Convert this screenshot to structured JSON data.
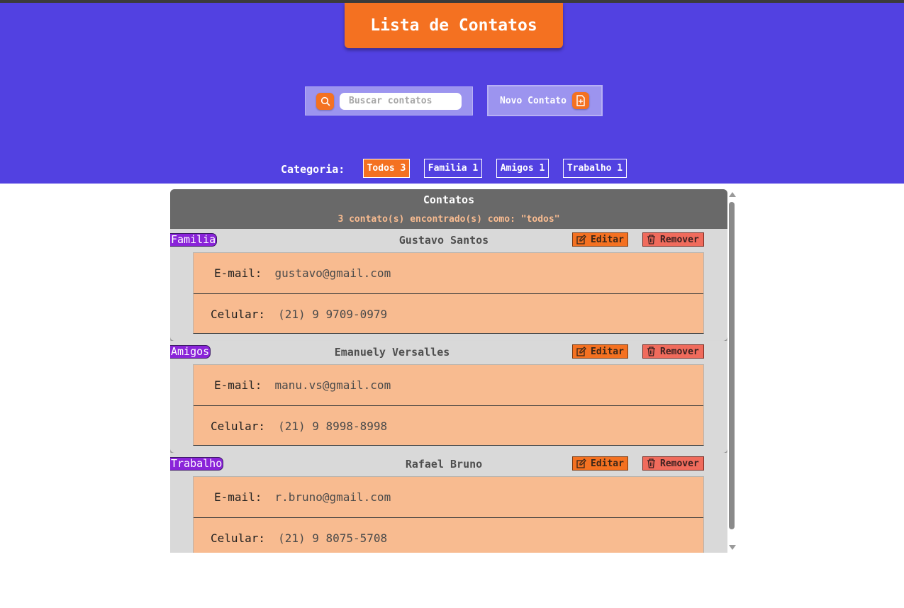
{
  "header": {
    "title": "Lista de Contatos",
    "search": {
      "placeholder": "Buscar contatos",
      "value": "",
      "icon": "search-icon"
    },
    "new_contact": {
      "label": "Novo Contato",
      "icon": "file-plus-icon"
    },
    "category": {
      "label": "Categoria:",
      "options": [
        {
          "label": "Todos 3",
          "active": true
        },
        {
          "label": "Familia 1",
          "active": false
        },
        {
          "label": "Amigos 1",
          "active": false
        },
        {
          "label": "Trabalho 1",
          "active": false
        }
      ]
    }
  },
  "panel": {
    "title": "Contatos",
    "subtitle": "3 contato(s) encontrado(s) como: \"todos\"",
    "edit_label": "Editar",
    "remove_label": "Remover",
    "email_label": "E-mail:",
    "phone_label": "Celular:",
    "contacts": [
      {
        "category": "Familia",
        "name": "Gustavo Santos",
        "email": "gustavo@gmail.com",
        "phone": "(21) 9 9709-0979"
      },
      {
        "category": "Amigos",
        "name": "Emanuely Versalles",
        "email": "manu.vs@gmail.com",
        "phone": "(21) 9 8998-8998"
      },
      {
        "category": "Trabalho",
        "name": "Rafael Bruno",
        "email": "r.bruno@gmail.com",
        "phone": "(21) 9 8075-5708"
      }
    ]
  },
  "colors": {
    "header_bg": "#5241e1",
    "accent": "#f47121",
    "badge": "#8a24d9",
    "card": "#f8bb90",
    "remove": "#f06b5c"
  }
}
